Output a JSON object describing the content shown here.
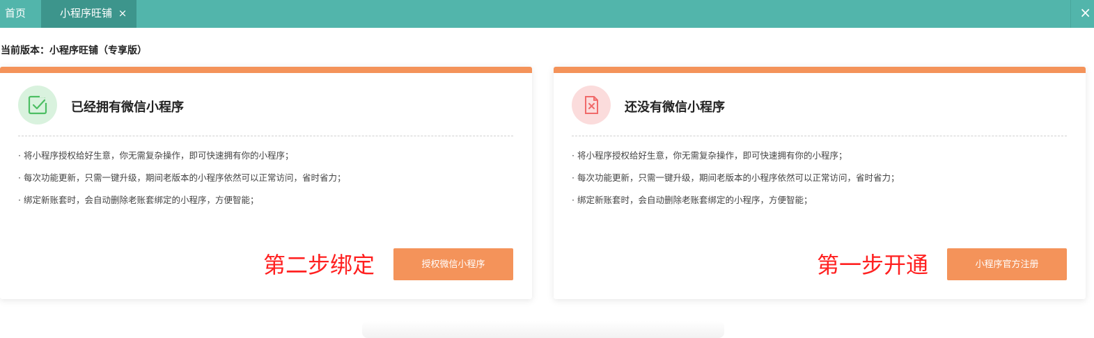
{
  "tabs": {
    "home_label": "首页",
    "active_label": "小程序旺铺",
    "close_glyph": "×",
    "global_close_glyph": "×"
  },
  "version": {
    "text": "当前版本：小程序旺铺（专享版）"
  },
  "cards": {
    "left": {
      "title": "已经拥有微信小程序",
      "items": [
        "将小程序授权给好生意，你无需复杂操作，即可快速拥有你的小程序；",
        "每次功能更新，只需一键升级，期间老版本的小程序依然可以正常访问，省时省力；",
        "绑定新账套时，会自动删除老账套绑定的小程序，方便智能；"
      ],
      "step_label": "第二步绑定",
      "button_label": "授权微信小程序",
      "icon": "check-document-icon",
      "accent": "#f4935a"
    },
    "right": {
      "title": "还没有微信小程序",
      "items": [
        "将小程序授权给好生意，你无需复杂操作，即可快速拥有你的小程序；",
        "每次功能更新，只需一键升级，期间老版本的小程序依然可以正常访问，省时省力；",
        "绑定新账套时，会自动删除老账套绑定的小程序，方便智能；"
      ],
      "step_label": "第一步开通",
      "button_label": "小程序官方注册",
      "icon": "x-document-icon",
      "accent": "#f4935a"
    }
  },
  "colors": {
    "tabbar": "#52b5ab",
    "active_tab": "#3d958c",
    "accent_orange": "#f4935a",
    "step_red": "#ff2020",
    "success_green": "#4cbe63",
    "danger_red": "#f06a6a"
  }
}
